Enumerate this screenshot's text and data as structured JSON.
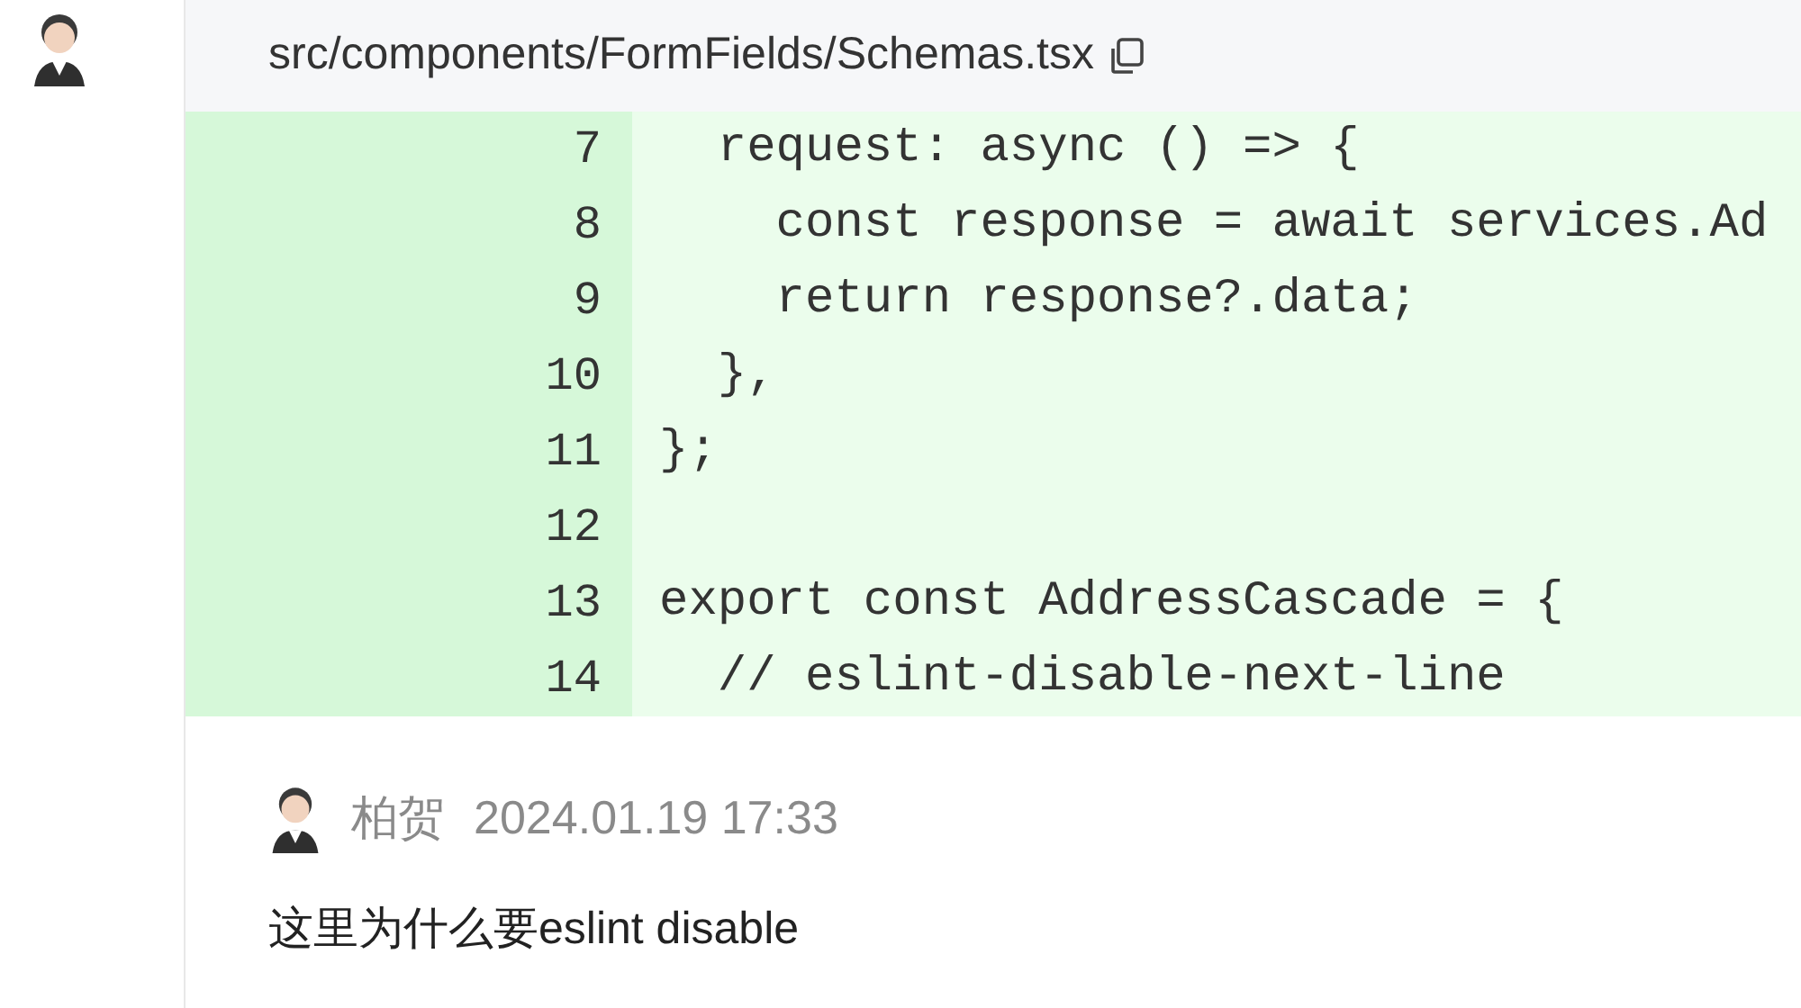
{
  "file_header": {
    "path": "src/components/FormFields/Schemas.tsx"
  },
  "code_lines": [
    {
      "number": "7",
      "text": "  request: async () => {"
    },
    {
      "number": "8",
      "text": "    const response = await services.Ad"
    },
    {
      "number": "9",
      "text": "    return response?.data;"
    },
    {
      "number": "10",
      "text": "  },"
    },
    {
      "number": "11",
      "text": "};"
    },
    {
      "number": "12"
    },
    {
      "number": "13",
      "text": "export const AddressCascade = {"
    },
    {
      "number": "14",
      "text": "  // eslint-disable-next-line"
    }
  ],
  "comment": {
    "author": "柏贺",
    "time": "2024.01.19 17:33",
    "body": "这里为什么要eslint disable"
  }
}
